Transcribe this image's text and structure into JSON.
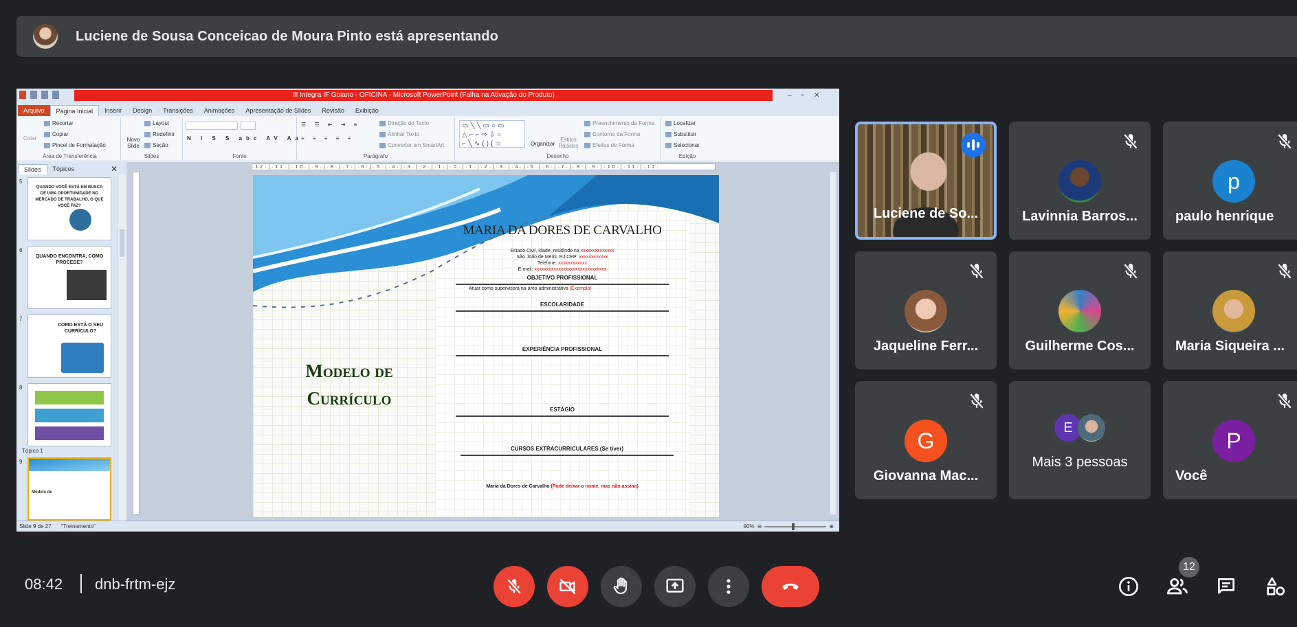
{
  "banner": {
    "text": "Luciene de Sousa Conceicao de Moura Pinto está apresentando"
  },
  "powerpoint": {
    "window_title": "III Integra IF Goiano - OFICINA - Microsoft PowerPoint (Falha na Ativação do Produto)",
    "tabs": [
      "Arquivo",
      "Página Inicial",
      "Inserir",
      "Design",
      "Transições",
      "Animações",
      "Apresentação de Slides",
      "Revisão",
      "Exibição"
    ],
    "ribbon": {
      "clipboard": {
        "label": "Área de Transferência",
        "paste": "Colar",
        "cut": "Recortar",
        "copy": "Copiar",
        "format_painter": "Pincel de Formatação"
      },
      "slides": {
        "label": "Slides",
        "new_slide": "Novo Slide",
        "layout": "Layout",
        "reset": "Redefinir",
        "section": "Seção"
      },
      "font": {
        "label": "Fonte"
      },
      "paragraph": {
        "label": "Parágrafo",
        "text_direction": "Direção do Texto",
        "align_text": "Alinhar Texto",
        "smartart": "Converter em SmartArt"
      },
      "drawing": {
        "label": "Desenho",
        "arrange": "Organizar",
        "quick_styles": "Estilos Rápidos",
        "shape_fill": "Preenchimento da Forma",
        "shape_outline": "Contorno da Forma",
        "shape_effects": "Efeitos de Forma"
      },
      "editing": {
        "label": "Edição",
        "find": "Localizar",
        "replace": "Substituir",
        "select": "Selecionar"
      }
    },
    "left_tabs": [
      "Slides",
      "Tópicos"
    ],
    "thumbnails": [
      {
        "num": "5",
        "title": "QUANDO VOCÊ ESTÁ EM BUSCA DE UMA OPORTUNIDADE NO MERCADO DE TRABALHO, O QUE VOCÊ FAZ?"
      },
      {
        "num": "6",
        "title": "QUANDO ENCONTRA, COMO PROCEDE?"
      },
      {
        "num": "7",
        "title": "COMO ESTÁ O SEU CURRÍCULO?"
      },
      {
        "num": "8",
        "title": ""
      },
      {
        "num": "9",
        "title": ""
      }
    ],
    "section_label": "Tópico 1",
    "ruler_top": "·12·|·11·|·10·|·9·|·8·|·7·|·6·|·5·|·4·|·3·|·2·|·1·|·0·|·1·|·2·|·3·|·4·|·5·|·6·|·7·|·8·|·9·|·10·|·11·|·12·",
    "slide": {
      "modelo_line1": "Modelo de",
      "modelo_line2": "Currículo",
      "cv_name": "MARIA DA DORES DE CARVALHO",
      "info_line1": "Estado Civil, Idade, residindo na ",
      "info_line1_red": "xxxxxxxxxxxxxx",
      "info_line2": "São João de Meriti, RJ CEP: ",
      "info_line2_red": "xxxxxxxxxxxx",
      "info_line3": "Telefone: ",
      "info_line3_red": "xxxxxxxxxxxx",
      "info_line4": "E-mail: ",
      "info_line4_red": "xxxxxxxxxxxxxxxxxxxxxxxxxxxxxx",
      "sec_objetivo": "OBJETIVO PROFISSIONAL",
      "objetivo_text": "Atuar como supervisora na área administrativa ",
      "objetivo_red": "(Exemplo)",
      "sec_escolaridade": "ESCOLARIDADE",
      "sec_experiencia": "EXPERIÊNCIA PROFISSIONAL",
      "sec_estagio": "ESTÁGIO",
      "sec_cursos": "CURSOS EXTRACURRICULARES (Se tiver)",
      "footer_text": "Maria da Dores de Carvalho ",
      "footer_red": "(Pode deixar o nome, mas não assina)"
    },
    "status": {
      "slide": "Slide 9 de 27",
      "theme": "\"Treinamento\"",
      "zoom": "90%"
    }
  },
  "participants": [
    {
      "name": "Luciene de So...",
      "speaking": true
    },
    {
      "name": "Lavinnia Barros...",
      "muted": true
    },
    {
      "name": "paulo henrique",
      "initial": "p",
      "color": "#1a82d0",
      "muted": true
    },
    {
      "name": "Jaqueline Ferr...",
      "muted": true
    },
    {
      "name": "Guilherme Cos...",
      "muted": true
    },
    {
      "name": "Maria Siqueira ...",
      "muted": true
    },
    {
      "name": "Giovanna Mac...",
      "initial": "G",
      "color": "#f4511e",
      "muted": true
    },
    {
      "name": "Mais 3 pessoas",
      "initial": "E",
      "color": "#5e35b1"
    },
    {
      "name": "Você",
      "initial": "P",
      "color": "#7b1fa2",
      "muted": true
    }
  ],
  "meeting": {
    "time": "08:42",
    "code": "dnb-frtm-ejz",
    "participant_count": "12"
  },
  "colors": {
    "background": "#202124",
    "tile": "#3c4043",
    "end_call": "#ea4335",
    "speaking_border": "#8ab4f8"
  }
}
